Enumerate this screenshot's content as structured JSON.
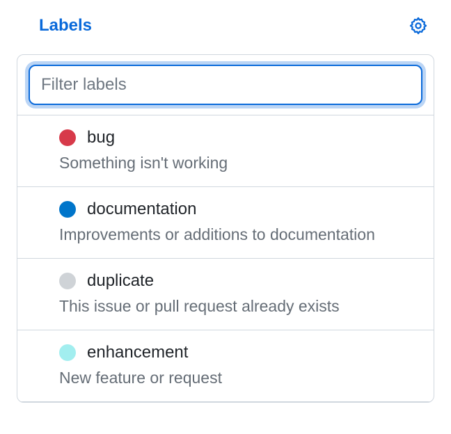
{
  "header": {
    "title": "Labels"
  },
  "search": {
    "placeholder": "Filter labels",
    "value": ""
  },
  "labels": [
    {
      "name": "bug",
      "description": "Something isn't working",
      "color": "#d73a4a"
    },
    {
      "name": "documentation",
      "description": "Improvements or additions to documentation",
      "color": "#0075ca"
    },
    {
      "name": "duplicate",
      "description": "This issue or pull request already exists",
      "color": "#cfd3d7"
    },
    {
      "name": "enhancement",
      "description": "New feature or request",
      "color": "#a2eeef"
    }
  ]
}
